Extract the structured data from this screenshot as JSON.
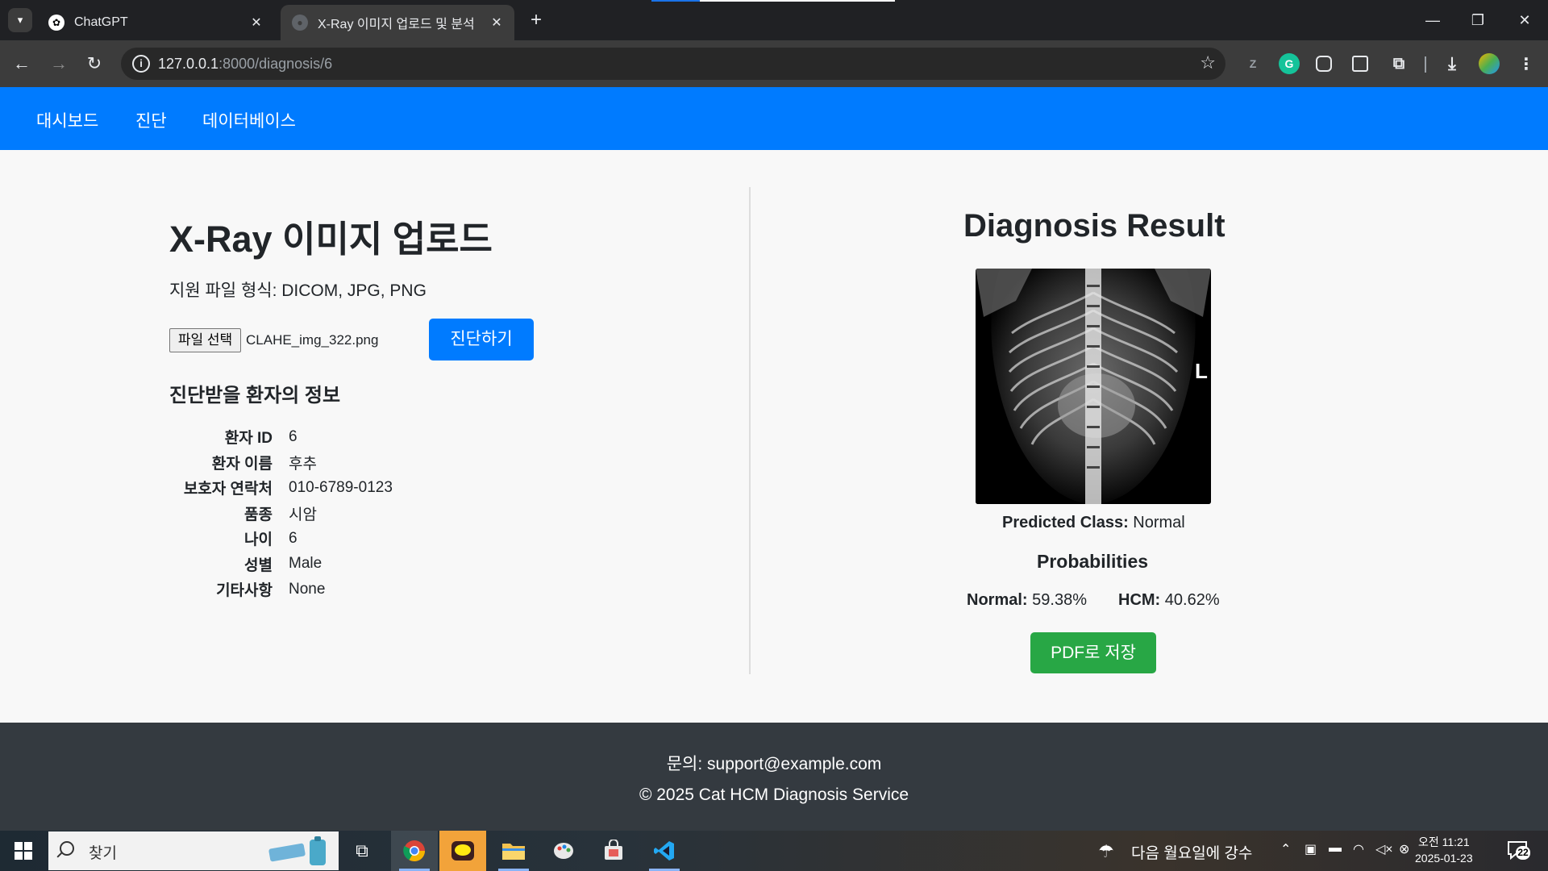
{
  "browser": {
    "tabs": [
      {
        "title": "ChatGPT",
        "active": false
      },
      {
        "title": "X-Ray 이미지 업로드 및 분석",
        "active": true
      }
    ],
    "url_host": "127.0.0.1",
    "url_path": ":8000/diagnosis/6"
  },
  "navbar": {
    "items": [
      "대시보드",
      "진단",
      "데이터베이스"
    ]
  },
  "upload": {
    "title": "X-Ray 이미지 업로드",
    "formats": "지원 파일 형식: DICOM, JPG, PNG",
    "file_button": "파일 선택",
    "file_name": "CLAHE_img_322.png",
    "submit_label": "진단하기"
  },
  "patient": {
    "heading": "진단받을 환자의 정보",
    "rows": [
      {
        "label": "환자 ID",
        "value": "6"
      },
      {
        "label": "환자 이름",
        "value": "후추"
      },
      {
        "label": "보호자 연락처",
        "value": "010-6789-0123"
      },
      {
        "label": "품종",
        "value": "시암"
      },
      {
        "label": "나이",
        "value": "6"
      },
      {
        "label": "성별",
        "value": "Male"
      },
      {
        "label": "기타사항",
        "value": "None"
      }
    ]
  },
  "result": {
    "title": "Diagnosis Result",
    "xray_marker": "L",
    "predicted_label": "Predicted Class:",
    "predicted_value": "Normal",
    "prob_heading": "Probabilities",
    "normal_label": "Normal:",
    "normal_value": "59.38%",
    "hcm_label": "HCM:",
    "hcm_value": "40.62%",
    "pdf_label": "PDF로 저장"
  },
  "footer": {
    "contact": "문의: support@example.com",
    "copyright": "© 2025 Cat HCM Diagnosis Service"
  },
  "taskbar": {
    "search_placeholder": "찾기",
    "weather": "다음 월요일에 강수",
    "time": "오전 11:21",
    "date": "2025-01-23",
    "notifications": "22"
  },
  "colors": {
    "navbar": "#007bff",
    "primary_button": "#007bff",
    "success_button": "#28a745",
    "footer": "#343a40"
  }
}
